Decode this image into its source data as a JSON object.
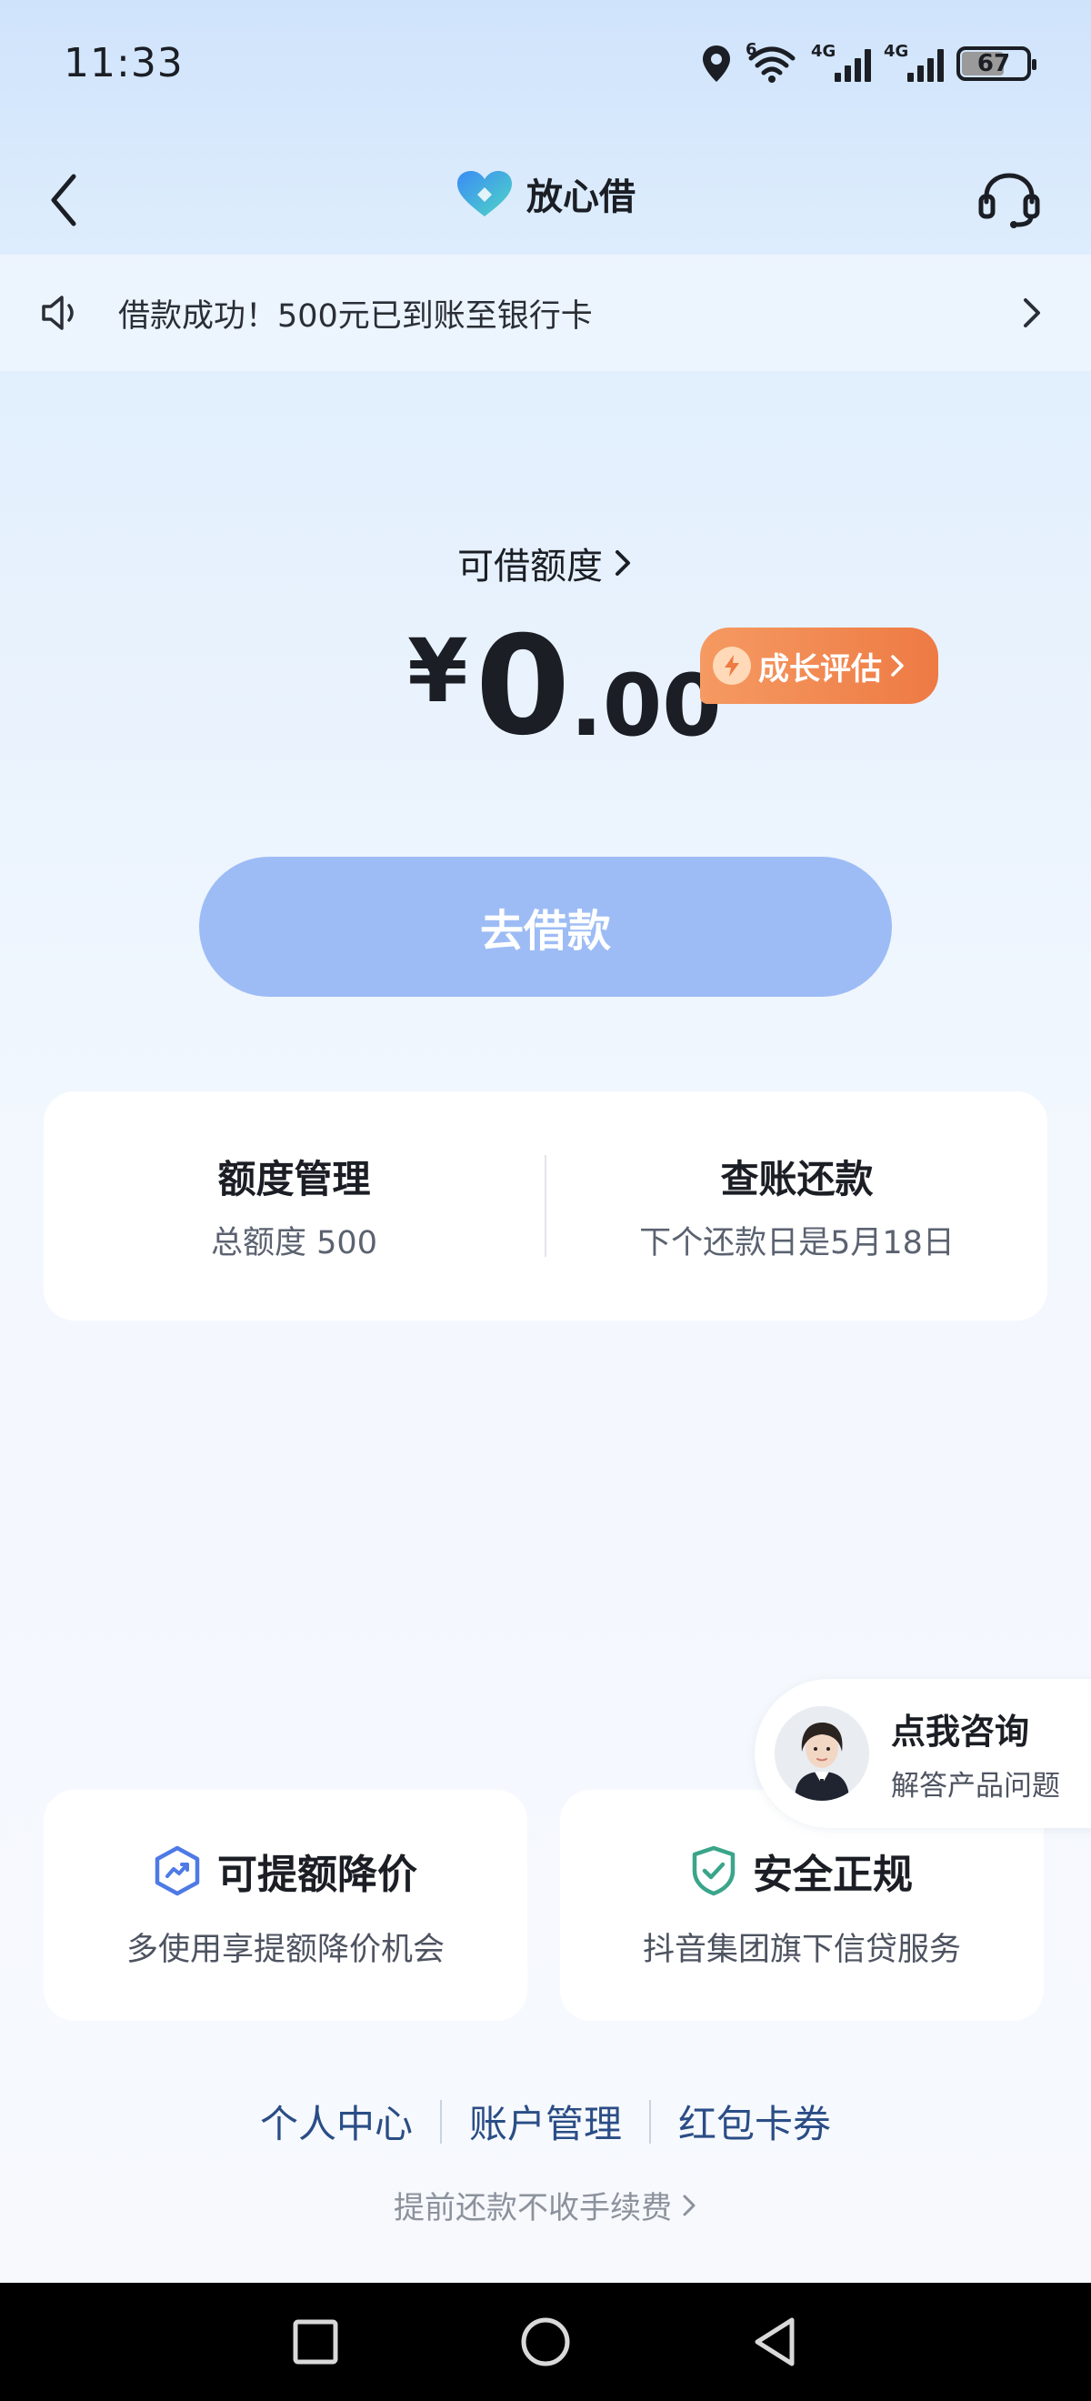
{
  "status_bar": {
    "time": "11:33",
    "network_1": "4G",
    "network_2": "4G",
    "wifi_tag": "6",
    "battery": "67"
  },
  "header": {
    "app_name": "放心借",
    "back_icon": "chevron-left-icon",
    "support_icon": "headset-icon"
  },
  "notice": {
    "text": "借款成功！500元已到账至银行卡",
    "icon": "speaker-icon"
  },
  "credit": {
    "label": "可借额度",
    "symbol": "¥",
    "integer": "0",
    "decimal": ".00",
    "growth_label": "成长评估"
  },
  "borrow_button": "去借款",
  "quick_actions": [
    {
      "title": "额度管理",
      "subtitle": "总额度 500"
    },
    {
      "title": "查账还款",
      "subtitle": "下个还款日是5月18日"
    }
  ],
  "consult": {
    "title": "点我咨询",
    "subtitle": "解答产品问题"
  },
  "features": [
    {
      "title": "可提额降价",
      "subtitle": "多使用享提额降价机会",
      "icon": "trend-up-icon"
    },
    {
      "title": "安全正规",
      "subtitle": "抖音集团旗下信贷服务",
      "icon": "shield-check-icon"
    }
  ],
  "footer_links": [
    "个人中心",
    "账户管理",
    "红包卡券"
  ],
  "prepay_note": "提前还款不收手续费",
  "colors": {
    "primary_button": "#9dbcf5",
    "badge_orange": "#ee7a44",
    "link_blue": "#2a4d86",
    "feature_icon_blue": "#4e7ae6",
    "feature_icon_green": "#3aa58a"
  }
}
